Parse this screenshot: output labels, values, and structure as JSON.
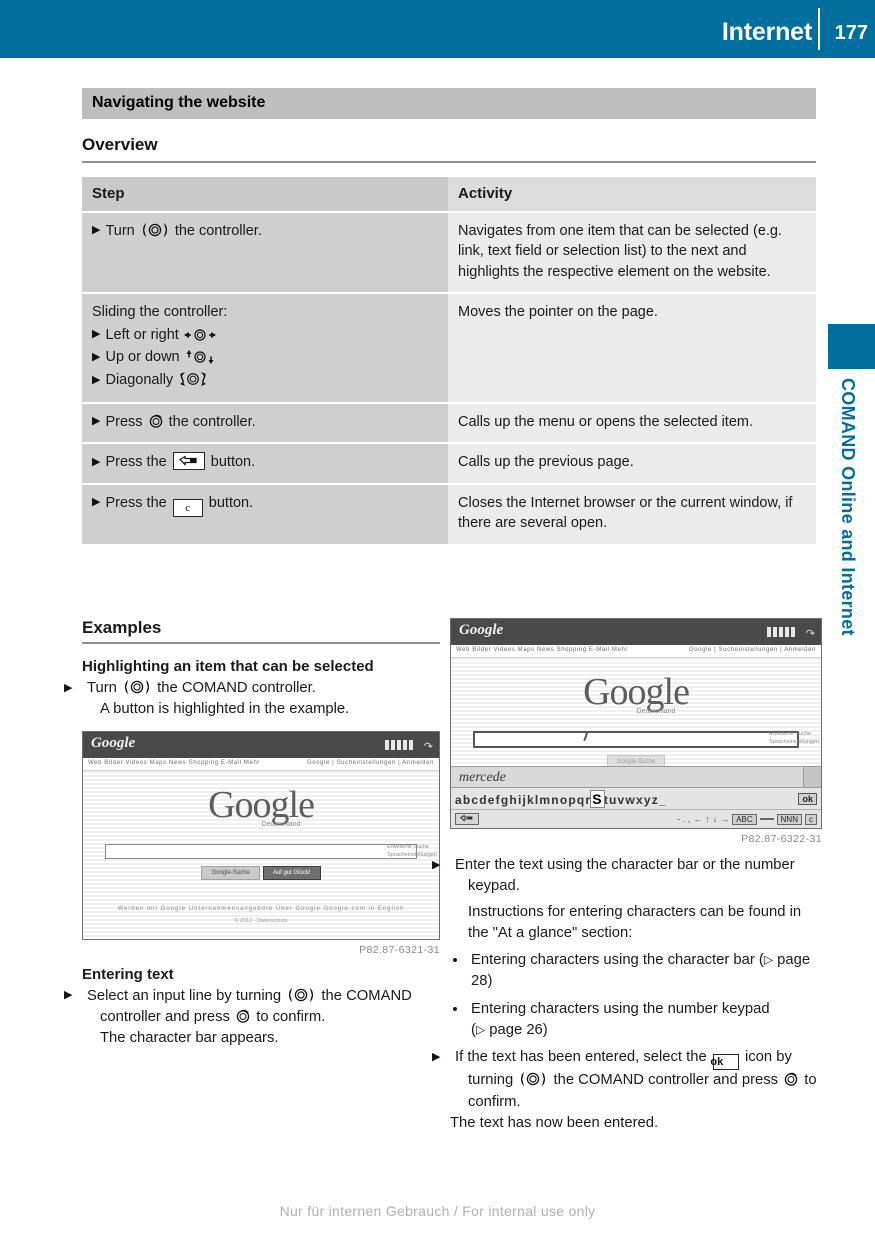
{
  "header": {
    "title": "Internet",
    "page_number": "177"
  },
  "sidebar": {
    "vertical_label": "COMAND Online and Internet"
  },
  "section": {
    "title": "Navigating the website",
    "overview_heading": "Overview"
  },
  "table": {
    "headers": [
      "Step",
      "Activity"
    ],
    "rows": [
      {
        "step_prefix": "Turn",
        "step_suffix": "the controller.",
        "step_icon": "comand-turn-icon",
        "activity": "Navigates from one item that can be selected (e.g. link, text field or selection list) to the next and highlights the respective element on the website."
      },
      {
        "step_intro": "Sliding the controller:",
        "sub_steps": [
          {
            "label": "Left or right",
            "icon": "slide-left-right-icon"
          },
          {
            "label": "Up or down",
            "icon": "slide-up-down-icon"
          },
          {
            "label": "Diagonally",
            "icon": "slide-diagonal-icon"
          }
        ],
        "activity": "Moves the pointer on the page."
      },
      {
        "step_prefix": "Press",
        "step_suffix": "the controller.",
        "step_icon": "comand-press-icon",
        "activity": "Calls up the menu or opens the selected item."
      },
      {
        "step_prefix": "Press the",
        "step_suffix": "button.",
        "step_icon": "back-button-icon",
        "activity": "Calls up the previous page."
      },
      {
        "step_prefix": "Press the",
        "step_suffix": "button.",
        "step_icon": "clear-c-button-icon",
        "step_icon_label": "c",
        "activity": "Closes the Internet browser or the current window, if there are several open."
      }
    ]
  },
  "examples": {
    "heading": "Examples",
    "left": {
      "subhead": "Highlighting an item that can be selected",
      "step_prefix": "Turn",
      "step_suffix": "the COMAND controller.",
      "result": "A button is highlighted in the example.",
      "figure_caption": "P82.87-6321-31",
      "entering_text_head": "Entering text",
      "entering_step_a": "Select an input line by turning",
      "entering_step_b": "the COMAND controller and press",
      "entering_step_c": "to confirm.",
      "entering_result": "The character bar appears."
    },
    "right": {
      "figure_caption": "P82.87-6322-31",
      "step1": "Enter the text using the character bar or the number keypad.",
      "note": "Instructions for entering characters can be found in the \"At a glance\" section:",
      "bullets": [
        {
          "text": "Entering characters using the character bar",
          "ref": "page 28"
        },
        {
          "text": "Entering characters using the number keypad",
          "ref": "page 26"
        }
      ],
      "step2_a": "If the text has been entered, select the",
      "step2_icon_label": "ok",
      "step2_b": "icon by turning",
      "step2_c": "the COMAND",
      "step2_d": "controller and press",
      "step2_e": "to confirm.",
      "step2_result": "The text has now been entered."
    }
  },
  "screenshots": {
    "left": {
      "brand": "Google",
      "nav_left": "Web  Bilder  Videos  Maps  News  Shopping  E-Mail  Mehr",
      "nav_right": "Google  |  Sucheinstellungen  |  Anmelden",
      "logo": "Google",
      "logo_sub": "Deutschland",
      "side_note_1": "Erweiterte Suche",
      "side_note_2": "Spracheinstellungen",
      "button_primary": "Google-Suche",
      "button_secondary": "Auf gut Glück!",
      "footer_links": "Werben mit Google    Unternehmensangebote    Über Google    Google.com in English",
      "copyright": "© 2012 - Datenschutz"
    },
    "right": {
      "brand": "Google",
      "nav_left": "Web  Bilder  Videos  Maps  News  Shopping  E-Mail  Mehr",
      "nav_right": "Google  |  Sucheinstellungen  |  Anmelden",
      "logo": "Google",
      "logo_sub": "Deutschland",
      "side_note_1": "Erweiterte Suche",
      "side_note_2": "Spracheinstellungen",
      "input_value": "mercede",
      "character_bar": "abcdefghijklmnopqr",
      "character_bar_highlight": "S",
      "character_bar_rest": "tuvwxyz_",
      "ok_label": "ok",
      "toolbar_punct": "- . ,",
      "toolbar_abc": "ABC",
      "toolbar_space": "",
      "toolbar_nnn": "NNN",
      "toolbar_c": "c"
    }
  },
  "footer": {
    "text": "Nur für internen Gebrauch / For internal use only"
  },
  "colors": {
    "brand_blue": "#006f9e",
    "section_gray": "#bebebe",
    "table_col1": "#cfcfcf",
    "table_col2": "#ebebeb"
  }
}
